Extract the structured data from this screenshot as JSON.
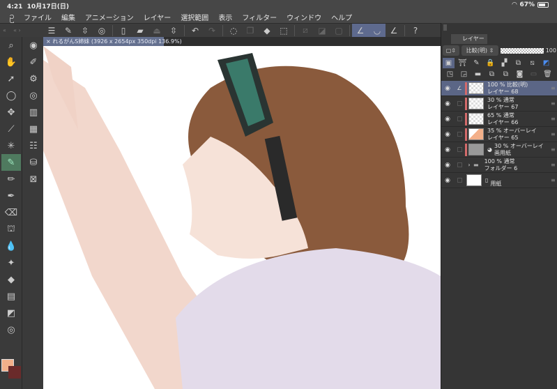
{
  "status": {
    "time": "4:21",
    "date": "10月17日(日)",
    "battery": "67%",
    "battery_level": 0.67
  },
  "menu": [
    "ファイル",
    "編集",
    "アニメーション",
    "レイヤー",
    "選択範囲",
    "表示",
    "フィルター",
    "ウィンドウ",
    "ヘルプ"
  ],
  "canvas_tab": {
    "title": "れるがんS姉妹 (3926 x 2654px 350dpi 136.9%)"
  },
  "layer_panel": {
    "tab": "レイヤー",
    "blend_mode": "比較(明)",
    "opacity": "100",
    "layers": [
      {
        "line1": "100 % 比較(明)",
        "line2": "レイヤー 68",
        "selected": true
      },
      {
        "line1": "30 % 通常",
        "line2": "レイヤー 67"
      },
      {
        "line1": "65 % 通常",
        "line2": "レイヤー 66"
      },
      {
        "line1": "35 % オーバーレイ",
        "line2": "レイヤー 65"
      },
      {
        "line1": "30 % オーバーレイ",
        "line2": "画用紙"
      },
      {
        "line1": "100 % 通常",
        "line2": "フォルダー 6"
      },
      {
        "line1": "",
        "line2": "用紙"
      }
    ]
  },
  "colors": {
    "main": "#f3b08a",
    "sub": "#6a2a2a",
    "accent": "#5b6686"
  }
}
